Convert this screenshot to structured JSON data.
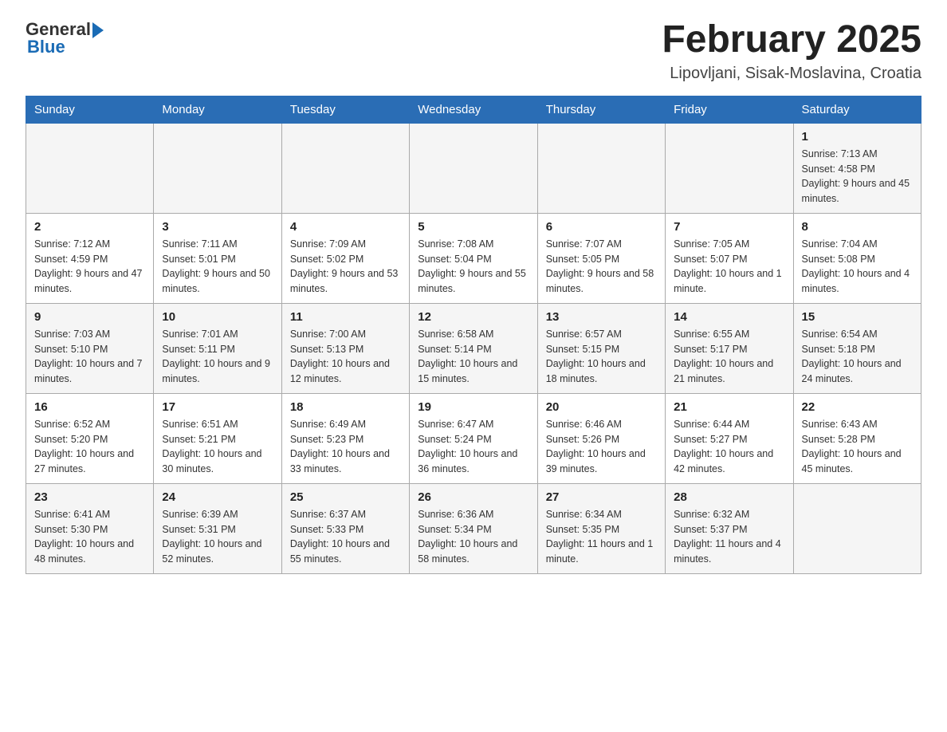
{
  "logo": {
    "general": "General",
    "blue": "Blue"
  },
  "header": {
    "month": "February 2025",
    "location": "Lipovljani, Sisak-Moslavina, Croatia"
  },
  "weekdays": [
    "Sunday",
    "Monday",
    "Tuesday",
    "Wednesday",
    "Thursday",
    "Friday",
    "Saturday"
  ],
  "weeks": [
    [
      {
        "day": "",
        "info": ""
      },
      {
        "day": "",
        "info": ""
      },
      {
        "day": "",
        "info": ""
      },
      {
        "day": "",
        "info": ""
      },
      {
        "day": "",
        "info": ""
      },
      {
        "day": "",
        "info": ""
      },
      {
        "day": "1",
        "info": "Sunrise: 7:13 AM\nSunset: 4:58 PM\nDaylight: 9 hours and 45 minutes."
      }
    ],
    [
      {
        "day": "2",
        "info": "Sunrise: 7:12 AM\nSunset: 4:59 PM\nDaylight: 9 hours and 47 minutes."
      },
      {
        "day": "3",
        "info": "Sunrise: 7:11 AM\nSunset: 5:01 PM\nDaylight: 9 hours and 50 minutes."
      },
      {
        "day": "4",
        "info": "Sunrise: 7:09 AM\nSunset: 5:02 PM\nDaylight: 9 hours and 53 minutes."
      },
      {
        "day": "5",
        "info": "Sunrise: 7:08 AM\nSunset: 5:04 PM\nDaylight: 9 hours and 55 minutes."
      },
      {
        "day": "6",
        "info": "Sunrise: 7:07 AM\nSunset: 5:05 PM\nDaylight: 9 hours and 58 minutes."
      },
      {
        "day": "7",
        "info": "Sunrise: 7:05 AM\nSunset: 5:07 PM\nDaylight: 10 hours and 1 minute."
      },
      {
        "day": "8",
        "info": "Sunrise: 7:04 AM\nSunset: 5:08 PM\nDaylight: 10 hours and 4 minutes."
      }
    ],
    [
      {
        "day": "9",
        "info": "Sunrise: 7:03 AM\nSunset: 5:10 PM\nDaylight: 10 hours and 7 minutes."
      },
      {
        "day": "10",
        "info": "Sunrise: 7:01 AM\nSunset: 5:11 PM\nDaylight: 10 hours and 9 minutes."
      },
      {
        "day": "11",
        "info": "Sunrise: 7:00 AM\nSunset: 5:13 PM\nDaylight: 10 hours and 12 minutes."
      },
      {
        "day": "12",
        "info": "Sunrise: 6:58 AM\nSunset: 5:14 PM\nDaylight: 10 hours and 15 minutes."
      },
      {
        "day": "13",
        "info": "Sunrise: 6:57 AM\nSunset: 5:15 PM\nDaylight: 10 hours and 18 minutes."
      },
      {
        "day": "14",
        "info": "Sunrise: 6:55 AM\nSunset: 5:17 PM\nDaylight: 10 hours and 21 minutes."
      },
      {
        "day": "15",
        "info": "Sunrise: 6:54 AM\nSunset: 5:18 PM\nDaylight: 10 hours and 24 minutes."
      }
    ],
    [
      {
        "day": "16",
        "info": "Sunrise: 6:52 AM\nSunset: 5:20 PM\nDaylight: 10 hours and 27 minutes."
      },
      {
        "day": "17",
        "info": "Sunrise: 6:51 AM\nSunset: 5:21 PM\nDaylight: 10 hours and 30 minutes."
      },
      {
        "day": "18",
        "info": "Sunrise: 6:49 AM\nSunset: 5:23 PM\nDaylight: 10 hours and 33 minutes."
      },
      {
        "day": "19",
        "info": "Sunrise: 6:47 AM\nSunset: 5:24 PM\nDaylight: 10 hours and 36 minutes."
      },
      {
        "day": "20",
        "info": "Sunrise: 6:46 AM\nSunset: 5:26 PM\nDaylight: 10 hours and 39 minutes."
      },
      {
        "day": "21",
        "info": "Sunrise: 6:44 AM\nSunset: 5:27 PM\nDaylight: 10 hours and 42 minutes."
      },
      {
        "day": "22",
        "info": "Sunrise: 6:43 AM\nSunset: 5:28 PM\nDaylight: 10 hours and 45 minutes."
      }
    ],
    [
      {
        "day": "23",
        "info": "Sunrise: 6:41 AM\nSunset: 5:30 PM\nDaylight: 10 hours and 48 minutes."
      },
      {
        "day": "24",
        "info": "Sunrise: 6:39 AM\nSunset: 5:31 PM\nDaylight: 10 hours and 52 minutes."
      },
      {
        "day": "25",
        "info": "Sunrise: 6:37 AM\nSunset: 5:33 PM\nDaylight: 10 hours and 55 minutes."
      },
      {
        "day": "26",
        "info": "Sunrise: 6:36 AM\nSunset: 5:34 PM\nDaylight: 10 hours and 58 minutes."
      },
      {
        "day": "27",
        "info": "Sunrise: 6:34 AM\nSunset: 5:35 PM\nDaylight: 11 hours and 1 minute."
      },
      {
        "day": "28",
        "info": "Sunrise: 6:32 AM\nSunset: 5:37 PM\nDaylight: 11 hours and 4 minutes."
      },
      {
        "day": "",
        "info": ""
      }
    ]
  ]
}
